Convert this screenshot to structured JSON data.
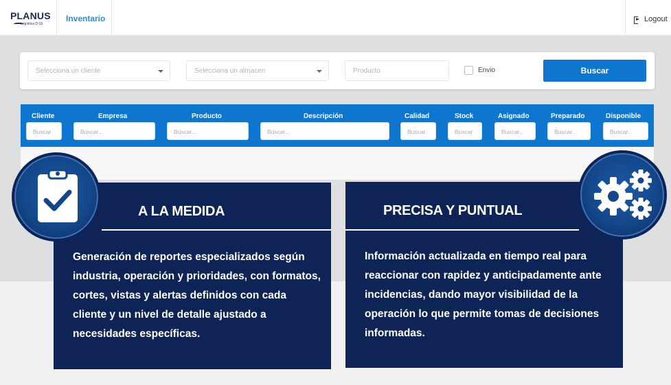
{
  "navbar": {
    "brand_name": "PLANUS",
    "brand_tagline": "Logística D-15",
    "nav_link": "Inventario",
    "logout_label": "Logout"
  },
  "filters": {
    "cliente_placeholder": "Selecciona un cliente",
    "almacen_placeholder": "Selecciona un almacen",
    "producto_placeholder": "Producto",
    "envio_label": "Envio",
    "envio_checked": false,
    "buscar_label": "Buscar"
  },
  "table": {
    "columns": [
      {
        "label": "Cliente",
        "placeholder": "Buscar"
      },
      {
        "label": "Empresa",
        "placeholder": "Buscar..."
      },
      {
        "label": "Producto",
        "placeholder": "Buscar..."
      },
      {
        "label": "Descripción",
        "placeholder": "Buscar..."
      },
      {
        "label": "Calidad",
        "placeholder": "Buscar"
      },
      {
        "label": "Stock",
        "placeholder": "Buscar"
      },
      {
        "label": "Asignado",
        "placeholder": "Buscar..."
      },
      {
        "label": "Preparado",
        "placeholder": "Buscar..."
      },
      {
        "label": "Disponible",
        "placeholder": "Buscar..."
      }
    ]
  },
  "panels": {
    "left": {
      "title": "A LA MEDIDA",
      "text": "Generación de reportes especializados según industria, operación y prioridades, con formatos, cortes, vistas y alertas definidos con cada cliente y un nivel de detalle ajustado a necesidades específicas.",
      "icon": "clipboard-check-icon"
    },
    "right": {
      "title": "PRECISA Y PUNTUAL",
      "text": "Información actualizada en tiempo real para reaccionar con rapidez y anticipadamente ante incidencias, dando mayor visibilidad de la operación lo que permite tomas de decisiones informadas.",
      "icon": "gears-icon"
    }
  },
  "colors": {
    "primary_blue": "#0f76d0",
    "navy": "#0e2356",
    "link_blue": "#2c8fd0"
  }
}
